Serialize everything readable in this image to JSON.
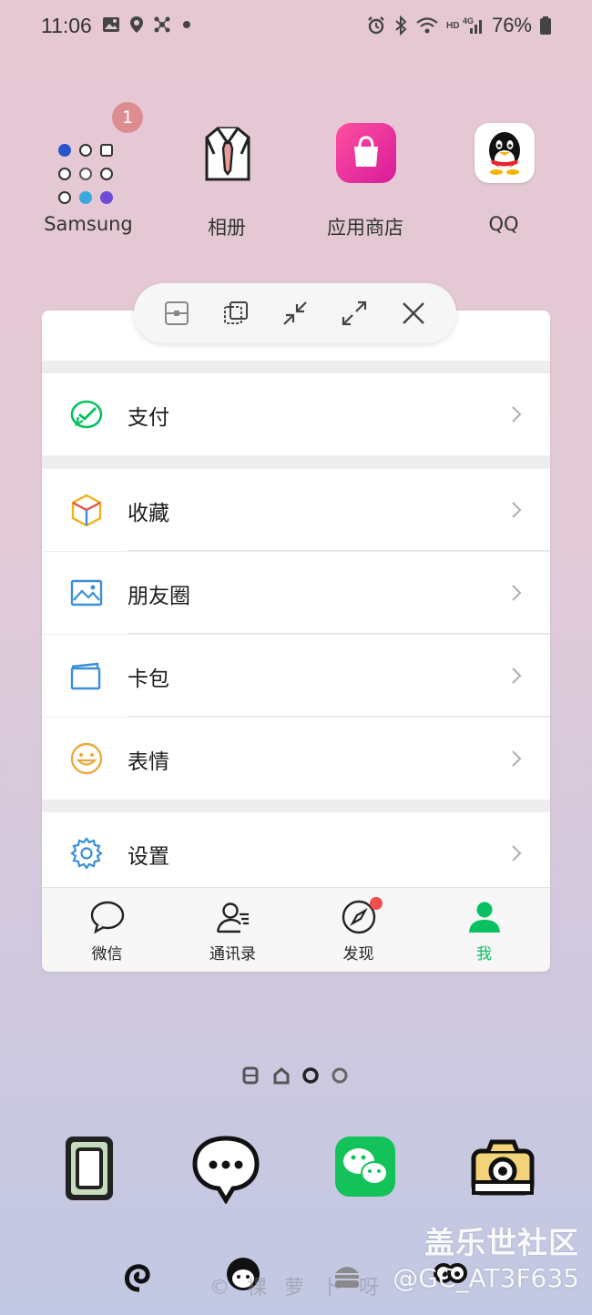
{
  "status_bar": {
    "time": "11:06",
    "battery_percent": "76%",
    "left_icons": [
      "gallery-icon",
      "location-icon",
      "network-icon",
      "dot-icon"
    ],
    "right_icons": [
      "alarm-icon",
      "bluetooth-icon",
      "wifi-icon",
      "hd-signal-icon",
      "battery-icon"
    ]
  },
  "home_apps": [
    {
      "label": "Samsung",
      "badge": "1"
    },
    {
      "label": "相册"
    },
    {
      "label": "应用商店"
    },
    {
      "label": "QQ"
    }
  ],
  "popup_toolbar": {
    "buttons": [
      "split-view-icon",
      "pop-up-view-icon",
      "minimize-icon",
      "maximize-icon",
      "close-icon"
    ]
  },
  "wechat_menu": {
    "items": [
      {
        "label": "支付",
        "icon": "payment-icon"
      },
      {
        "label": "收藏",
        "icon": "favorites-icon"
      },
      {
        "label": "朋友圈",
        "icon": "moments-icon"
      },
      {
        "label": "卡包",
        "icon": "card-wallet-icon"
      },
      {
        "label": "表情",
        "icon": "stickers-icon"
      },
      {
        "label": "设置",
        "icon": "settings-icon"
      }
    ]
  },
  "tabbar": {
    "tabs": [
      {
        "label": "微信",
        "icon": "chat-bubble-icon",
        "active": false
      },
      {
        "label": "通讯录",
        "icon": "contacts-icon",
        "active": false
      },
      {
        "label": "发现",
        "icon": "compass-icon",
        "active": false,
        "dot": true
      },
      {
        "label": "我",
        "icon": "person-icon",
        "active": true
      }
    ],
    "active_color": "#07c160"
  },
  "dock": {
    "apps": [
      "phone-frame-icon",
      "messages-icon",
      "wechat-icon",
      "camera-icon"
    ]
  },
  "watermark": {
    "line1": "盖乐世社区",
    "line2": "@GC_AT3F635",
    "line3": "©  棵  萝  卜  呀"
  }
}
